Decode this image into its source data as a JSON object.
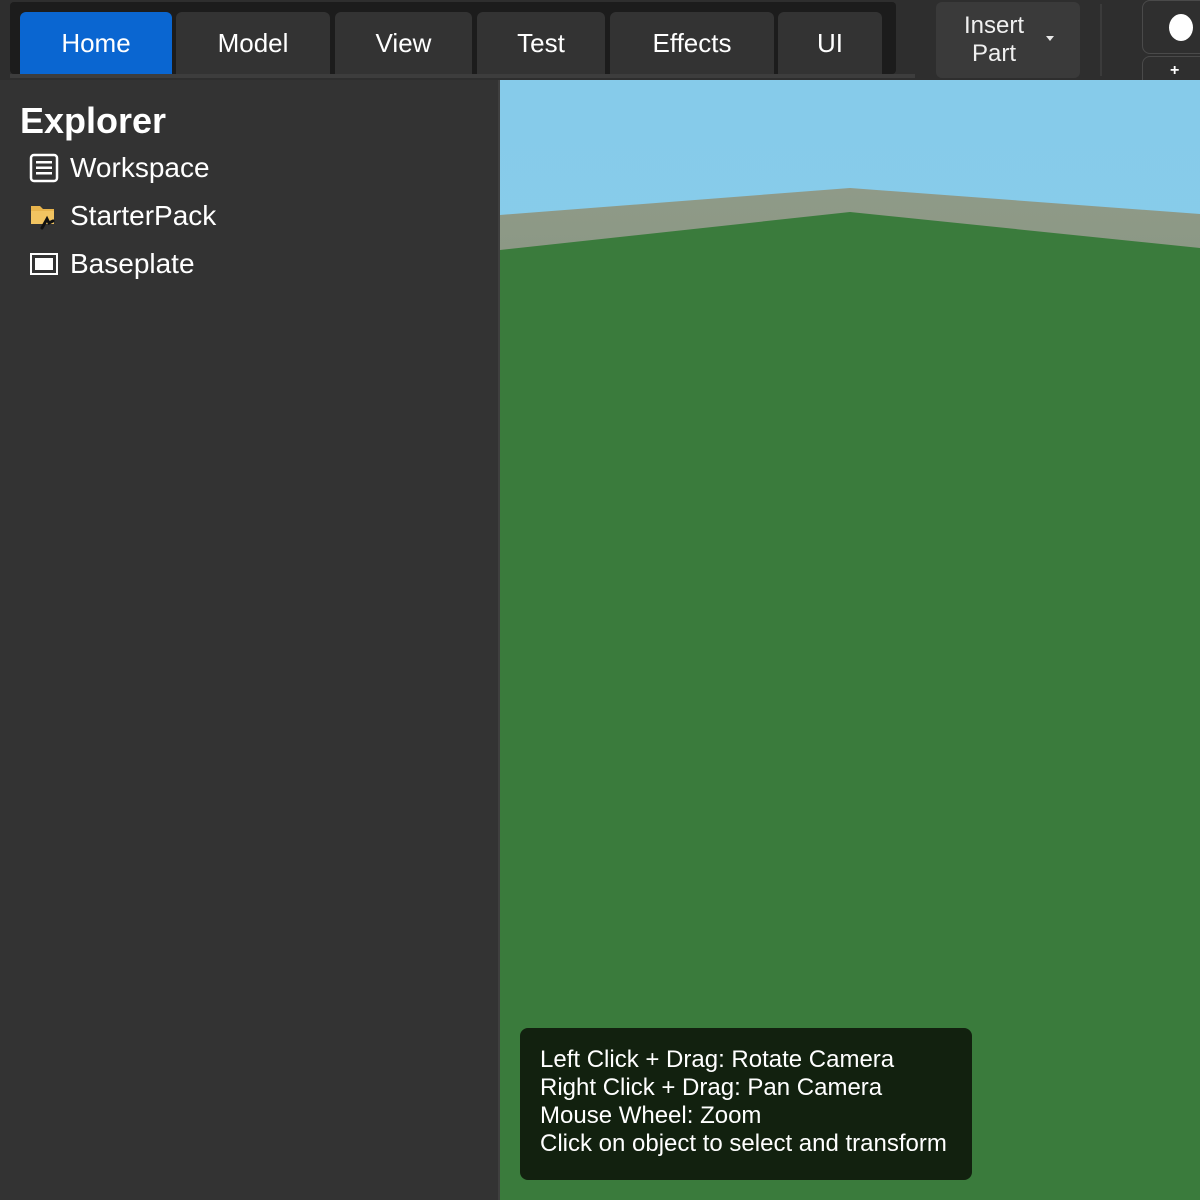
{
  "toolbar": {
    "tabs": [
      {
        "label": "Home",
        "active": true
      },
      {
        "label": "Model",
        "active": false
      },
      {
        "label": "View",
        "active": false
      },
      {
        "label": "Test",
        "active": false
      },
      {
        "label": "Effects",
        "active": false
      },
      {
        "label": "UI",
        "active": false
      }
    ],
    "insert_part_label": "Insert\nPart",
    "accent_color": "#0a66d1"
  },
  "explorer": {
    "title": "Explorer",
    "items": [
      {
        "label": "Workspace",
        "icon": "workspace-icon"
      },
      {
        "label": "StarterPack",
        "icon": "starterpack-folder-icon"
      },
      {
        "label": "Baseplate",
        "icon": "baseplate-icon"
      }
    ]
  },
  "viewport": {
    "sky_color": "#87ceeb",
    "ground_color": "#3a7b3c",
    "help_lines": [
      "Left Click + Drag: Rotate Camera",
      "Right Click + Drag: Pan Camera",
      "Mouse Wheel: Zoom",
      "Click on object to select and transform"
    ]
  }
}
